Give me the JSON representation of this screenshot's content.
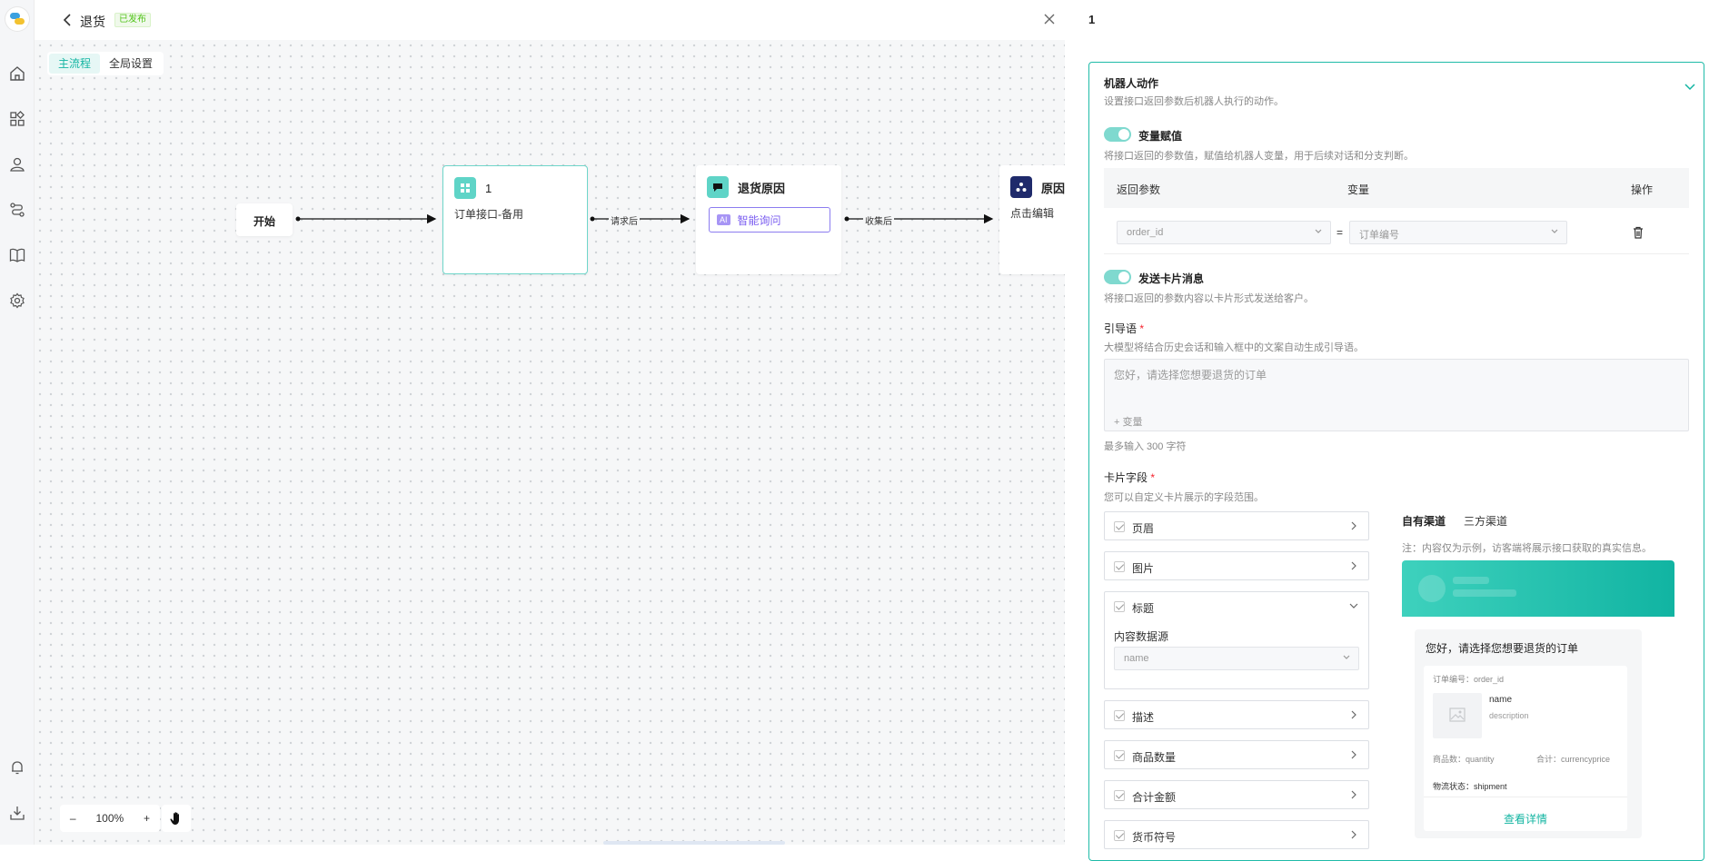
{
  "header": {
    "title": "退货",
    "status": "已发布"
  },
  "canvas": {
    "tabs": [
      {
        "label": "主流程"
      },
      {
        "label": "全局设置"
      }
    ],
    "nodes": {
      "start": {
        "label": "开始"
      },
      "api": {
        "title": "1",
        "subtitle": "订单接口-备用"
      },
      "reason": {
        "title": "退货原因",
        "ai_label": "智能询问",
        "ai_badge": "AI"
      },
      "partial": {
        "title": "原因",
        "subtitle": "点击编辑"
      }
    },
    "edges": [
      {
        "label": "请求后"
      },
      {
        "label": "收集后"
      }
    ],
    "zoom": {
      "minus": "–",
      "value": "100%",
      "plus": "+"
    }
  },
  "panel": {
    "title": "1",
    "robot_action": {
      "title": "机器人动作",
      "desc": "设置接口返回参数后机器人执行的动作。"
    },
    "var_assign": {
      "title": "变量赋值",
      "desc": "将接口返回的参数值，赋值给机器人变量，用于后续对话和分支判断。",
      "columns": [
        "返回参数",
        "变量",
        "操作"
      ],
      "row": {
        "param": "order_id",
        "equals": "=",
        "variable": "订单编号"
      }
    },
    "send_card": {
      "title": "发送卡片消息",
      "desc": "将接口返回的参数内容以卡片形式发送给客户。"
    },
    "guide": {
      "title": "引导语",
      "required": "*",
      "desc": "大模型将结合历史会话和输入框中的文案自动生成引导语。",
      "value": "您好，请选择您想要退货的订单",
      "add_var": "+ 变量",
      "limit": "最多输入 300 字符"
    },
    "card_fields": {
      "title": "卡片字段",
      "required": "*",
      "desc": "您可以自定义卡片展示的字段范围。",
      "items": [
        "页眉",
        "图片",
        "标题",
        "描述",
        "商品数量",
        "合计金额",
        "货币符号"
      ],
      "source_label": "内容数据源",
      "source_value": "name"
    },
    "preview": {
      "tabs": [
        "自有渠道",
        "三方渠道"
      ],
      "note": "注：内容仅为示例，访客端将展示接口获取的真实信息。",
      "greeting": "您好，请选择您想要退货的订单",
      "order_no": "订单编号：order_id",
      "name": "name",
      "description": "description",
      "qty": "商品数：quantity",
      "total": "合计：currencyprice",
      "shipment": "物流状态：shipment",
      "detail": "查看详情"
    }
  },
  "colors": {
    "accent": "#13b5a2",
    "ai": "#7a5cf0",
    "published": "#52c41a"
  }
}
